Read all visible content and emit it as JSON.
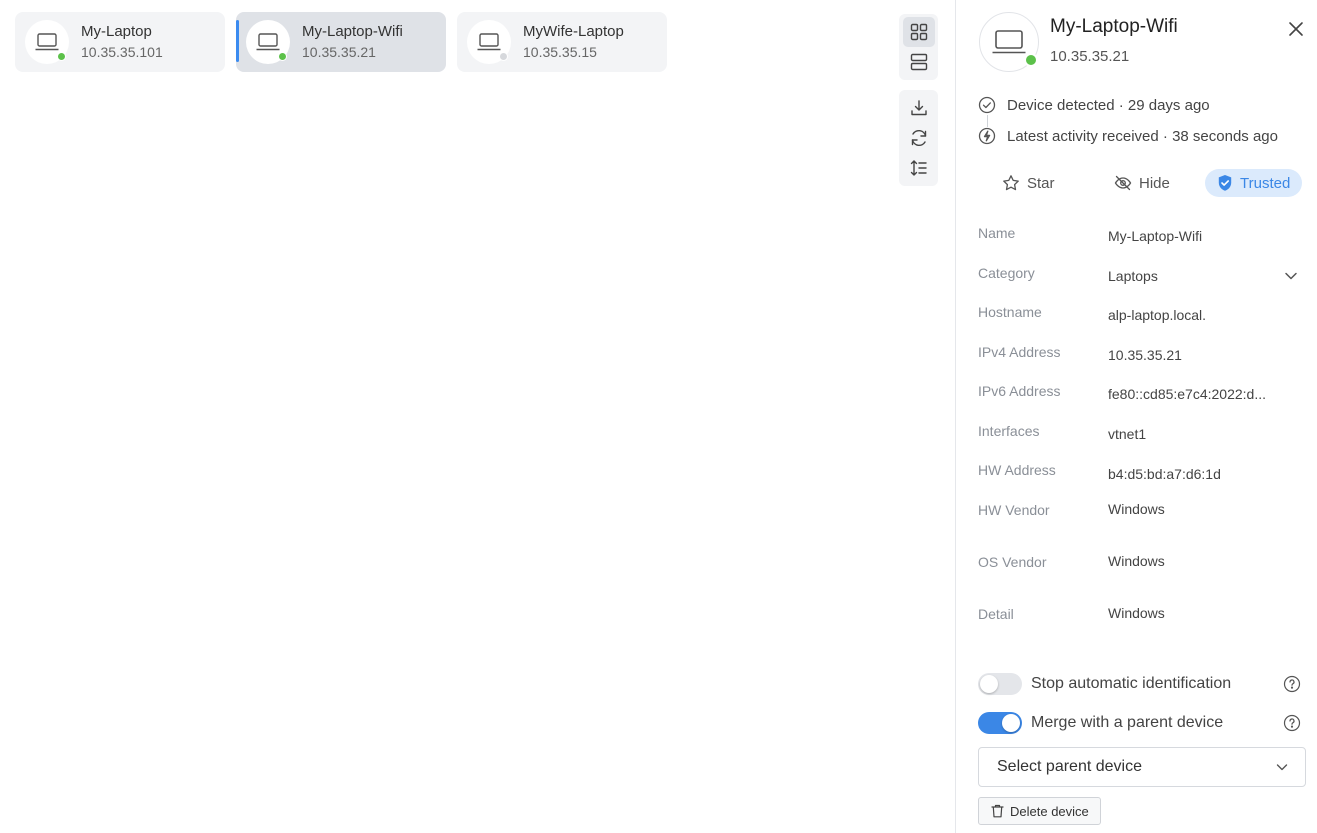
{
  "devices": [
    {
      "name": "My-Laptop",
      "ip": "10.35.35.101",
      "status_color": "#5cc14a"
    },
    {
      "name": "My-Laptop-Wifi",
      "ip": "10.35.35.21",
      "status_color": "#5cc14a"
    },
    {
      "name": "MyWife-Laptop",
      "ip": "10.35.35.15",
      "status_color": "#d6d8dc"
    }
  ],
  "toolbar": {
    "view_buttons": [
      "grid-view-icon",
      "list-view-icon"
    ],
    "action_buttons": [
      "download-icon",
      "refresh-icon",
      "sort-icon"
    ]
  },
  "detail": {
    "title": "My-Laptop-Wifi",
    "ip": "10.35.35.21",
    "status_color": "#5cc14a",
    "timeline": [
      "Device detected · 29 days ago",
      "Latest activity received · 38 seconds ago"
    ],
    "actions": {
      "star": "Star",
      "hide": "Hide",
      "trusted": "Trusted"
    },
    "fields": [
      {
        "label": "Name",
        "value": "My-Laptop-Wifi"
      },
      {
        "label": "Category",
        "value": "Laptops"
      },
      {
        "label": "Hostname",
        "value": "alp-laptop.local."
      },
      {
        "label": "IPv4 Address",
        "value": "10.35.35.21"
      },
      {
        "label": "IPv6 Address",
        "value": "fe80::cd85:e7c4:2022:d..."
      },
      {
        "label": "Interfaces",
        "value": "vtnet1"
      },
      {
        "label": "HW Address",
        "value": "b4:d5:bd:a7:d6:1d"
      },
      {
        "label": "HW Vendor",
        "value": "Windows"
      },
      {
        "label": "OS Vendor",
        "value": "Windows"
      },
      {
        "label": "Detail",
        "value": "Windows"
      }
    ],
    "toggles": [
      {
        "label": "Stop automatic identification",
        "on": false
      },
      {
        "label": "Merge with a parent device",
        "on": true
      }
    ],
    "parent_select": "Select parent device",
    "delete_label": "Delete device"
  },
  "colors": {
    "accent": "#3b87e6",
    "online": "#5cc14a",
    "offline": "#d6d8dc"
  }
}
